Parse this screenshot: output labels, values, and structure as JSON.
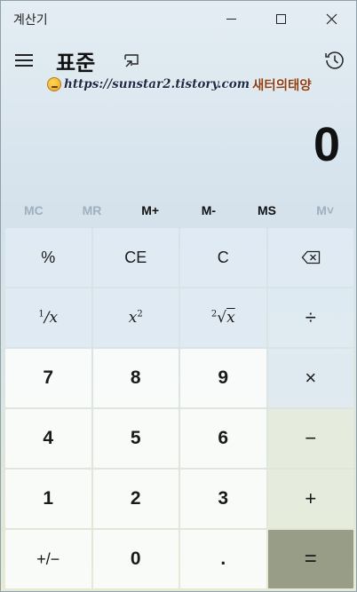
{
  "window": {
    "title": "계산기",
    "controls": {
      "minimize": "minimize-icon",
      "maximize": "maximize-icon",
      "close": "close-icon"
    }
  },
  "header": {
    "mode_title": "표준",
    "menu_icon": "hamburger-menu-icon",
    "keep_on_top_icon": "keep-on-top-icon",
    "history_icon": "history-icon"
  },
  "watermark": {
    "url": "https://sunstar2.tistory.com",
    "name": "새터의태양"
  },
  "display": {
    "value": "0"
  },
  "memory": [
    {
      "label": "MC",
      "enabled": false
    },
    {
      "label": "MR",
      "enabled": false
    },
    {
      "label": "M+",
      "enabled": true
    },
    {
      "label": "M-",
      "enabled": true
    },
    {
      "label": "MS",
      "enabled": true
    },
    {
      "label": "M˅",
      "enabled": false
    }
  ],
  "keys": {
    "percent": "%",
    "clear_entry": "CE",
    "clear": "C",
    "backspace": "backspace-icon",
    "reciprocal": {
      "num": "1",
      "den": "x"
    },
    "square": {
      "base": "x",
      "exp": "2"
    },
    "sqrt": {
      "index": "2",
      "radicand": "x"
    },
    "divide": "÷",
    "seven": "7",
    "eight": "8",
    "nine": "9",
    "multiply": "×",
    "four": "4",
    "five": "5",
    "six": "6",
    "minus": "−",
    "one": "1",
    "two": "2",
    "three": "3",
    "plus": "+",
    "negate": "+/−",
    "zero": "0",
    "decimal": ".",
    "equals": "="
  },
  "colors": {
    "equals_bg": "#979d87",
    "disabled_text": "#9fb0bf",
    "watermark_url": "#1e2a47",
    "watermark_name": "#8a3e14"
  }
}
